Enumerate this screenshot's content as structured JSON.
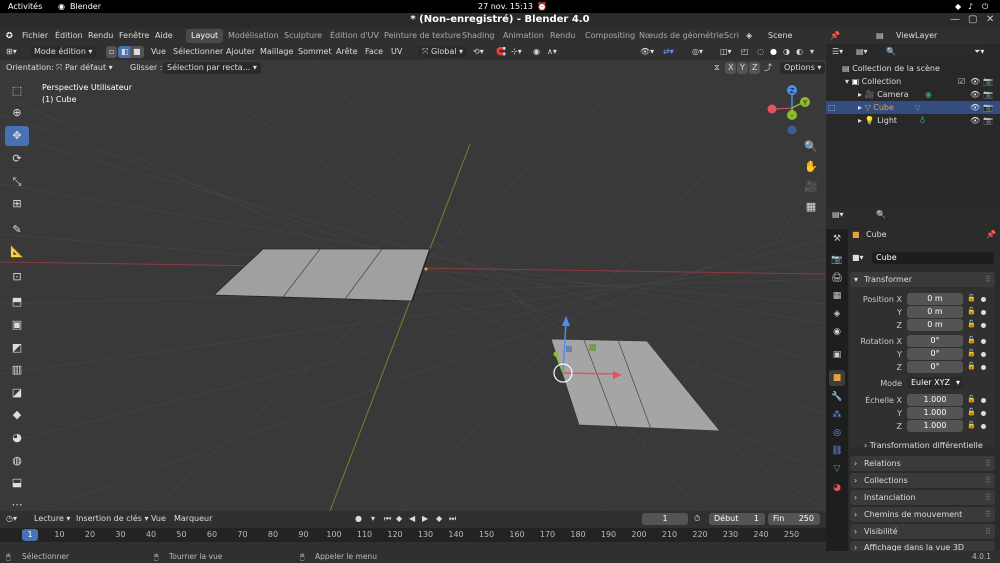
{
  "gnome": {
    "activities": "Activités",
    "app": "Blender",
    "clock": "27 nov.  15:13"
  },
  "window": {
    "title": "* (Non-enregistré) - Blender 4.0"
  },
  "menu": [
    "Fichier",
    "Édition",
    "Rendu",
    "Fenêtre",
    "Aide"
  ],
  "workspaces": [
    "Layout",
    "Modélisation",
    "Sculpture",
    "Édition d'UV",
    "Peinture de texture",
    "Shading",
    "Animation",
    "Rendu",
    "Compositing",
    "Nœuds de géométrie",
    "Scri"
  ],
  "scene": "Scene",
  "view_layer": "ViewLayer",
  "viewport_header": {
    "mode": "Mode édition",
    "menus": [
      "Vue",
      "Sélectionner",
      "Ajouter",
      "Maillage",
      "Sommet",
      "Arête",
      "Face",
      "UV"
    ],
    "orientation_global": "Global",
    "axes": [
      "X",
      "Y",
      "Z"
    ],
    "options": "Options"
  },
  "tool_settings": {
    "orientation_label": "Orientation:",
    "orientation_value": "Par défaut",
    "drag_label": "Glisser :",
    "drag_value": "Sélection par recta..."
  },
  "viewport_overlay": {
    "perspective": "Perspective Utilisateur",
    "object": "(1) Cube"
  },
  "gizmo_axes": [
    "X",
    "Y",
    "Z"
  ],
  "timeline": {
    "menus": [
      "Lecture",
      "Insertion de clés",
      "Vue",
      "Marqueur"
    ],
    "current_frame": "1",
    "start_label": "Début",
    "start": "1",
    "end_label": "Fin",
    "end": "250",
    "ticks": [
      "1",
      "10",
      "20",
      "30",
      "40",
      "50",
      "60",
      "70",
      "80",
      "90",
      "100",
      "110",
      "120",
      "130",
      "140",
      "150",
      "160",
      "170",
      "180",
      "190",
      "200",
      "210",
      "220",
      "230",
      "240",
      "250"
    ]
  },
  "statusbar": {
    "select": "Sélectionner",
    "rotate": "Tourner la vue",
    "menu": "Appeler le menu",
    "version": "4.0.1"
  },
  "outliner": {
    "root": "Collection de la scène",
    "items": [
      {
        "name": "Collection",
        "icon": "collection-icon"
      },
      {
        "name": "Camera",
        "icon": "camera-icon"
      },
      {
        "name": "Cube",
        "icon": "mesh-icon"
      },
      {
        "name": "Light",
        "icon": "light-icon"
      }
    ]
  },
  "properties": {
    "object_name": "Cube",
    "data_name": "Cube",
    "transform_title": "Transformer",
    "location_label": "Position X",
    "location": [
      "0 m",
      "0 m",
      "0 m"
    ],
    "rotation_label": "Rotation X",
    "rotation": [
      "0°",
      "0°",
      "0°"
    ],
    "mode_label": "Mode",
    "mode_value": "Euler XYZ",
    "scale_label": "Échelle X",
    "scale": [
      "1.000",
      "1.000",
      "1.000"
    ],
    "axis_y": "Y",
    "axis_z": "Z",
    "delta": "Transformation différentielle",
    "panels": [
      "Relations",
      "Collections",
      "Instanciation",
      "Chemins de mouvement",
      "Visibilité",
      "Affichage dans la vue 3D"
    ]
  },
  "colors": {
    "accent": "#4772b3",
    "x_axis": "#e5525f",
    "y_axis": "#8cbb2f",
    "z_axis": "#4a8ef0",
    "bg": "#393939"
  }
}
